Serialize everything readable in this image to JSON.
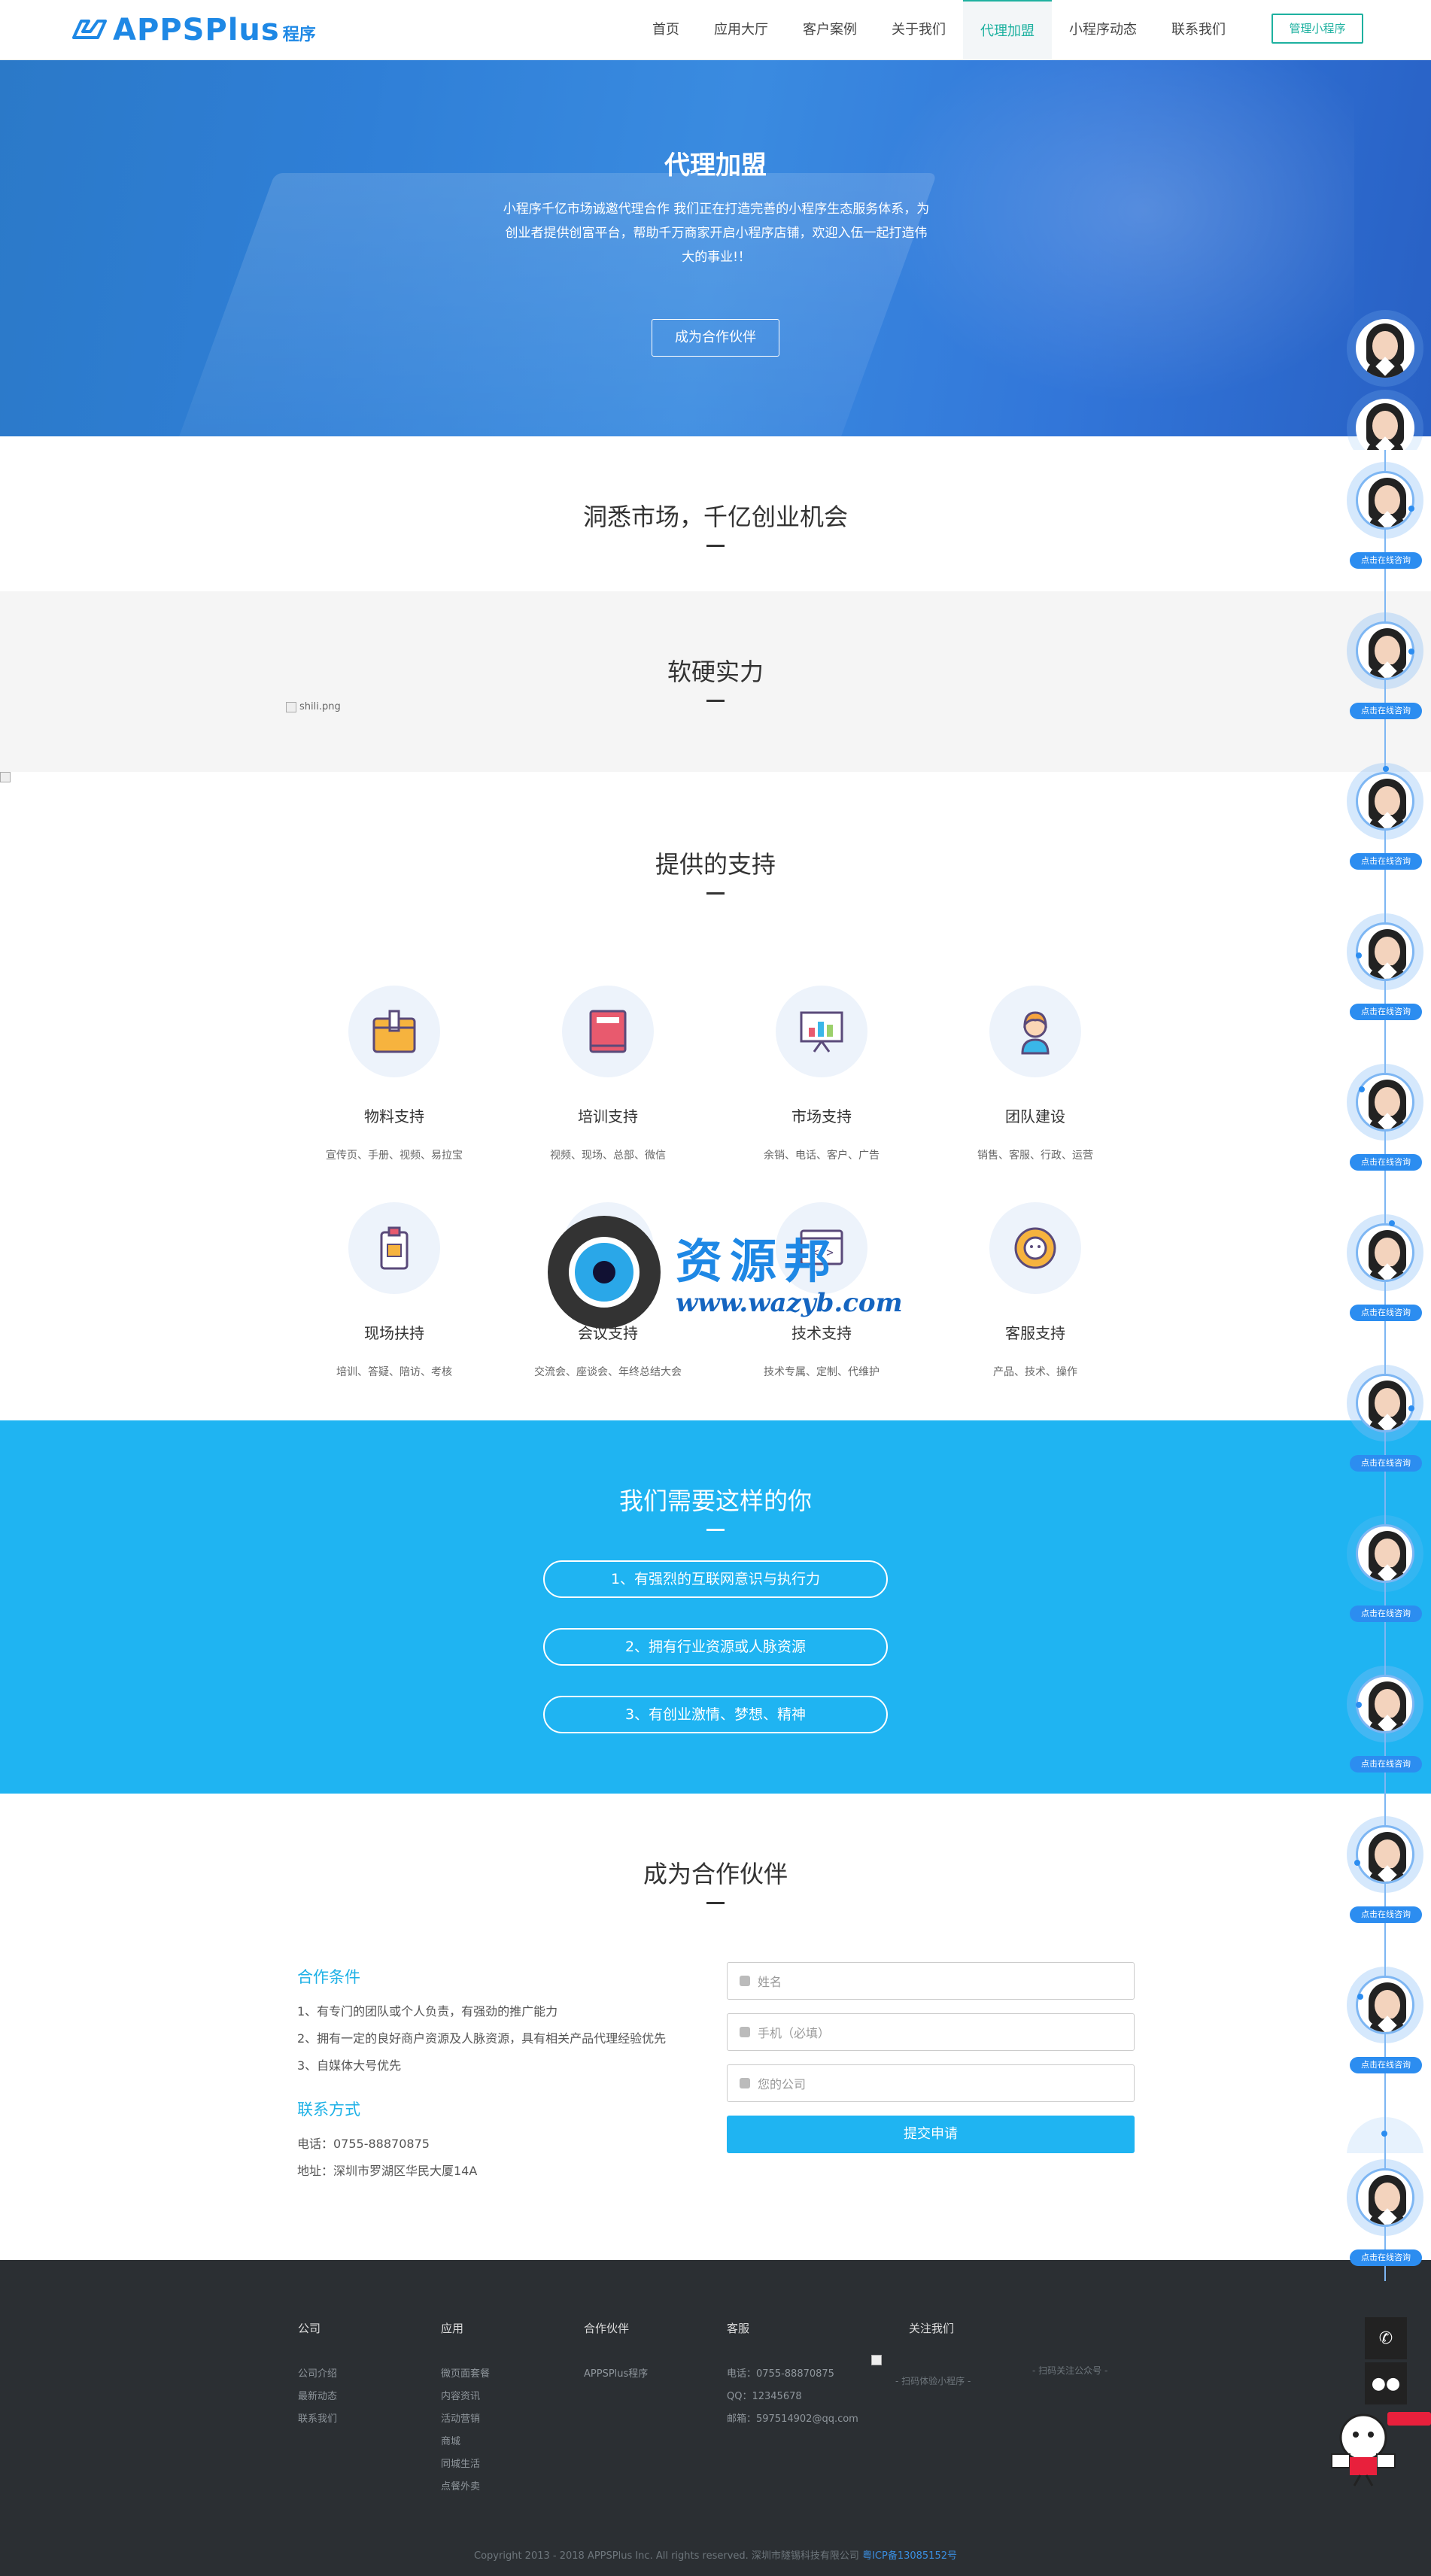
{
  "header": {
    "logo_text": "APPSPlus",
    "logo_sub": "程序",
    "nav": [
      "首页",
      "应用大厅",
      "客户案例",
      "关于我们",
      "代理加盟",
      "小程序动态",
      "联系我们"
    ],
    "active_nav": "代理加盟",
    "manage_button": "管理小程序"
  },
  "hero": {
    "title": "代理加盟",
    "text": "小程序千亿市场诚邀代理合作 我们正在打造完善的小程序生态服务体系，为创业者提供创富平台，帮助千万商家开启小程序店铺，欢迎入伍一起打造伟大的事业!！",
    "button": "成为合作伙伴"
  },
  "market": {
    "title": "洞悉市场，千亿创业机会"
  },
  "power": {
    "title": "软硬实力",
    "img_alt": "shili.png"
  },
  "support": {
    "title": "提供的支持",
    "cards": [
      {
        "title": "物料支持",
        "desc": "宣传页、手册、视频、易拉宝",
        "icon": "box-icon"
      },
      {
        "title": "培训支持",
        "desc": "视频、现场、总部、微信",
        "icon": "book-icon"
      },
      {
        "title": "市场支持",
        "desc": "余销、电话、客户、广告",
        "icon": "chart-board-icon"
      },
      {
        "title": "团队建设",
        "desc": "销售、客服、行政、运营",
        "icon": "person-icon"
      },
      {
        "title": "现场扶持",
        "desc": "培训、答疑、陪访、考核",
        "icon": "badge-icon"
      },
      {
        "title": "会议支持",
        "desc": "交流会、座谈会、年终总结大会",
        "icon": "meeting-icon"
      },
      {
        "title": "技术支持",
        "desc": "技术专属、定制、代维护",
        "icon": "code-window-icon"
      },
      {
        "title": "客服支持",
        "desc": "产品、技术、操作",
        "icon": "headset-icon"
      }
    ]
  },
  "need": {
    "title": "我们需要这样的你",
    "items": [
      "1、有强烈的互联网意识与执行力",
      "2、拥有行业资源或人脉资源",
      "3、有创业激情、梦想、精神"
    ]
  },
  "partner": {
    "title": "成为合作伙伴",
    "conditions_title": "合作条件",
    "conditions": [
      "1、有专门的团队或个人负责，有强劲的推广能力",
      "2、拥有一定的良好商户资源及人脉资源，具有相关产品代理经验优先",
      "3、自媒体大号优先"
    ],
    "contact_title": "联系方式",
    "phone": "电话：0755-88870875",
    "address": "地址：深圳市罗湖区华民大厦14A",
    "form": {
      "name": "姓名",
      "mobile": "手机（必填）",
      "company": "您的公司",
      "submit": "提交申请"
    }
  },
  "footer": {
    "cols": [
      {
        "title": "公司",
        "items": [
          "公司介绍",
          "最新动态",
          "联系我们"
        ]
      },
      {
        "title": "应用",
        "items": [
          "微页面套餐",
          "内容资讯",
          "活动营销",
          "商城",
          "同城生活",
          "点餐外卖"
        ]
      },
      {
        "title": "合作伙伴",
        "items": [
          "APPSPlus程序"
        ]
      },
      {
        "title": "客服",
        "items": [
          "电话：0755-88870875",
          "QQ：12345678",
          "邮箱：597514902@qq.com"
        ]
      }
    ],
    "follow_title": "关注我们",
    "qr_left": "- 扫码体验小程序 -",
    "qr_right": "- 扫码关注公众号 -",
    "copyright": "Copyright 2013 - 2018 APPSPlus Inc. All rights reserved. 深圳市隧锡科技有限公司",
    "icp": "粤ICP备13085152号"
  },
  "consult": {
    "label": "点击在线咨询"
  },
  "watermark": {
    "text": "资源邦",
    "url": "www.wazyb.com"
  }
}
